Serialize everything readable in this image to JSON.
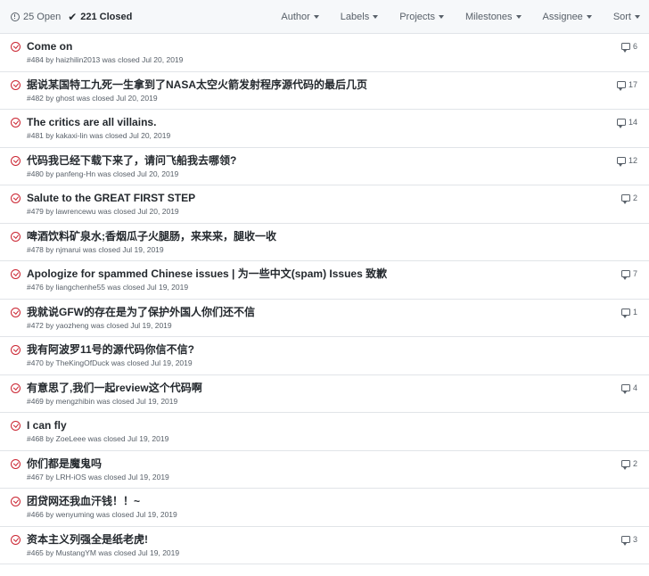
{
  "header": {
    "open_label": "25 Open",
    "closed_label": "221 Closed",
    "filters": [
      "Author",
      "Labels",
      "Projects",
      "Milestones",
      "Assignee",
      "Sort"
    ]
  },
  "issues": [
    {
      "title": "Come on",
      "number": "#484",
      "by": "by",
      "author": "haizhilin2013",
      "status": "was closed Jul 20, 2019",
      "comments": "6"
    },
    {
      "title": "据说某国特工九死一生拿到了NASA太空火箭发射程序源代码的最后几页",
      "number": "#482",
      "by": "by",
      "author": "ghost",
      "status": "was closed Jul 20, 2019",
      "comments": "17"
    },
    {
      "title": "The critics are all villains.",
      "number": "#481",
      "by": "by",
      "author": "kakaxi-lin",
      "status": "was closed Jul 20, 2019",
      "comments": "14"
    },
    {
      "title": "代码我已经下载下来了，请问飞船我去哪领?",
      "number": "#480",
      "by": "by",
      "author": "panfeng-Hn",
      "status": "was closed Jul 20, 2019",
      "comments": "12"
    },
    {
      "title": "Salute to the GREAT FIRST STEP",
      "number": "#479",
      "by": "by",
      "author": "lawrencewu",
      "status": "was closed Jul 20, 2019",
      "comments": "2"
    },
    {
      "title": "啤酒饮料矿泉水;香烟瓜子火腿肠，来来来，腿收一收",
      "number": "#478",
      "by": "by",
      "author": "njmarui",
      "status": "was closed Jul 19, 2019",
      "comments": ""
    },
    {
      "title": "Apologize for spammed Chinese issues | 为一些中文(spam) Issues 致歉",
      "number": "#476",
      "by": "by",
      "author": "liangchenhe55",
      "status": "was closed Jul 19, 2019",
      "comments": "7"
    },
    {
      "title": "我就说GFW的存在是为了保护外国人你们还不信",
      "number": "#472",
      "by": "by",
      "author": "yaozheng",
      "status": "was closed Jul 19, 2019",
      "comments": "1"
    },
    {
      "title": "我有阿波罗11号的源代码你信不信?",
      "number": "#470",
      "by": "by",
      "author": "TheKingOfDuck",
      "status": "was closed Jul 19, 2019",
      "comments": ""
    },
    {
      "title": "有意思了,我们一起review这个代码啊",
      "number": "#469",
      "by": "by",
      "author": "mengzhibin",
      "status": "was closed Jul 19, 2019",
      "comments": "4"
    },
    {
      "title": "I can fly",
      "number": "#468",
      "by": "by",
      "author": "ZoeLeee",
      "status": "was closed Jul 19, 2019",
      "comments": ""
    },
    {
      "title": "你们都是魔鬼吗",
      "number": "#467",
      "by": "by",
      "author": "LRH-iOS",
      "status": "was closed Jul 19, 2019",
      "comments": "2"
    },
    {
      "title": "团贷网还我血汗钱！！~",
      "number": "#466",
      "by": "by",
      "author": "wenyuming",
      "status": "was closed Jul 19, 2019",
      "comments": ""
    },
    {
      "title": "资本主义列强全是纸老虎!",
      "number": "#465",
      "by": "by",
      "author": "MustangYM",
      "status": "was closed Jul 19, 2019",
      "comments": "3"
    }
  ]
}
